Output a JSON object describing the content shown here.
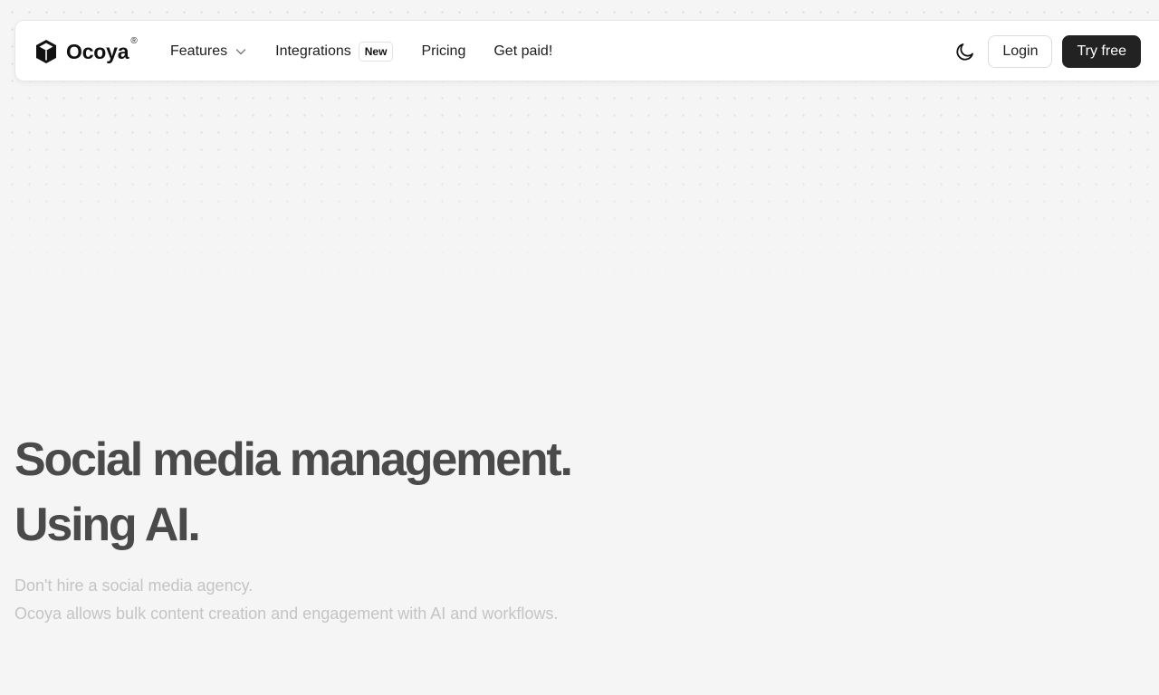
{
  "brand": {
    "name": "Ocoya",
    "registered_mark": "®",
    "logo_icon": "cube-icon"
  },
  "nav": {
    "items": [
      {
        "label": "Features",
        "has_dropdown": true
      },
      {
        "label": "Integrations",
        "badge": "New"
      },
      {
        "label": "Pricing"
      },
      {
        "label": "Get paid!"
      }
    ],
    "theme_toggle_icon": "moon-icon",
    "login_label": "Login",
    "try_label": "Try free"
  },
  "hero": {
    "title_line1": "Social media management.",
    "title_line2": "Using AI.",
    "subtitle_line1": "Don't hire a social media agency.",
    "subtitle_line2": "Ocoya allows bulk content creation and engagement with AI and workflows."
  },
  "colors": {
    "background": "#f5f5f5",
    "primary_button": "#222222",
    "title_text": "#4a4a4a",
    "subtitle_text": "#c4c4c4"
  }
}
